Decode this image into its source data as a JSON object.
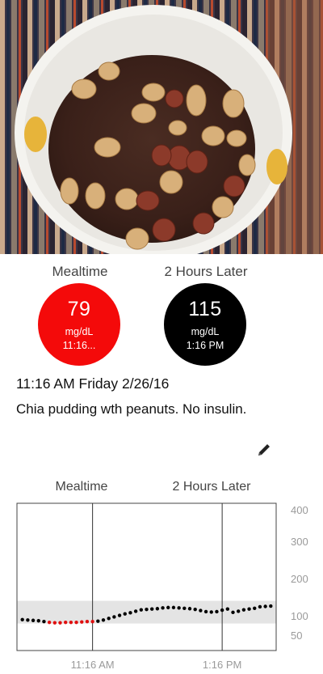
{
  "readings": {
    "mealtime": {
      "label": "Mealtime",
      "value": "79",
      "unit": "mg/dL",
      "time": "11:16...",
      "color": "#f40a0a"
    },
    "later": {
      "label": "2 Hours Later",
      "value": "115",
      "unit": "mg/dL",
      "time": "1:16 PM",
      "color": "#000000"
    }
  },
  "entry": {
    "datetime": "11:16 AM Friday 2/26/16",
    "note": "Chia pudding wth peanuts. No insulin.",
    "edit_icon": "pencil-icon"
  },
  "chart_labels": {
    "mealtime": "Mealtime",
    "later": "2 Hours Later"
  },
  "chart_data": {
    "type": "scatter",
    "title": "",
    "xlabel": "",
    "ylabel": "",
    "x_tick_labels": [
      "11:16 AM",
      "1:16 PM"
    ],
    "y_tick_labels": [
      "400",
      "300",
      "200",
      "100",
      "50"
    ],
    "ylim": [
      25,
      400
    ],
    "target_range": [
      80,
      140
    ],
    "grid": false,
    "markers": [
      {
        "label": "11:16 AM",
        "minutes": 0
      },
      {
        "label": "1:16 PM",
        "minutes": 120
      }
    ],
    "series": [
      {
        "values_minutes": [
          -65,
          -60,
          -55,
          -50,
          -45,
          -40,
          -35,
          -30,
          -25,
          -20,
          -15,
          -10,
          -5,
          0,
          5,
          10,
          15,
          20,
          25,
          30,
          35,
          40,
          45,
          50,
          55,
          60,
          65,
          70,
          75,
          80,
          85,
          90,
          95,
          100,
          105,
          110,
          115,
          120,
          125,
          130,
          135,
          140,
          145,
          150,
          155,
          160,
          165
        ],
        "values_mgdl": [
          90,
          89,
          88,
          87,
          85,
          83,
          82,
          82,
          83,
          83,
          83,
          84,
          85,
          85,
          86,
          89,
          93,
          97,
          101,
          105,
          108,
          112,
          116,
          117,
          118,
          119,
          121,
          122,
          122,
          121,
          120,
          119,
          117,
          114,
          111,
          110,
          111,
          115,
          118,
          109,
          112,
          116,
          118,
          120,
          124,
          125,
          126
        ],
        "red_from_minutes": -40,
        "red_to_minutes": 0,
        "color": "#000000",
        "highlight_color": "#e01010"
      }
    ]
  }
}
